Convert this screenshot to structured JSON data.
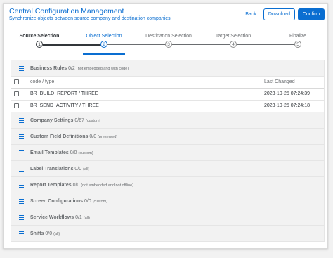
{
  "header": {
    "title": "Central Configuration Management",
    "subtitle": "Synchronize objects between source company and destination companies",
    "back_label": "Back",
    "download_label": "Download",
    "confirm_label": "Confirm"
  },
  "colors": {
    "accent": "#0a6ed1",
    "group_background": "#f2f2f2"
  },
  "wizard": {
    "steps": [
      {
        "label": "Source Selection",
        "number": "1",
        "state": "done"
      },
      {
        "label": "Object Selection",
        "number": "2",
        "state": "active"
      },
      {
        "label": "Destination Selection",
        "number": "3",
        "state": "pending"
      },
      {
        "label": "Target Selection",
        "number": "4",
        "state": "pending"
      },
      {
        "label": "Finalize",
        "number": "5",
        "state": "pending"
      }
    ]
  },
  "groups": [
    {
      "name": "Business Rules",
      "count": "0/2",
      "note": "(not embedded and with code)",
      "icon": "list-icon"
    },
    {
      "name": "Company Settings",
      "count": "0/67",
      "note": "(custom)",
      "icon": "list-icon"
    },
    {
      "name": "Custom Field Definitions",
      "count": "0/0",
      "note": "(preserved)",
      "icon": "list-icon"
    },
    {
      "name": "Email Templates",
      "count": "0/0",
      "note": "(custom)",
      "icon": "list-icon"
    },
    {
      "name": "Label Translations",
      "count": "0/0",
      "note": "(all)",
      "icon": "list-icon"
    },
    {
      "name": "Report Templates",
      "count": "0/0",
      "note": "(not embedded and not offline)",
      "icon": "list-icon"
    },
    {
      "name": "Screen Configurations",
      "count": "0/0",
      "note": "(custom)",
      "icon": "list-icon"
    },
    {
      "name": "Service Workflows",
      "count": "0/1",
      "note": "(all)",
      "icon": "list-icon"
    },
    {
      "name": "Shifts",
      "count": "0/0",
      "note": "(all)",
      "icon": "list-icon"
    }
  ],
  "table": {
    "columns": [
      "code / type",
      "Last Changed"
    ],
    "rows": [
      {
        "code": "BR_BUILD_REPORT / THREE",
        "changed": "2023-10-25 07:24:39"
      },
      {
        "code": "BR_SEND_ACTIVITY / THREE",
        "changed": "2023-10-25 07:24:18"
      }
    ]
  }
}
